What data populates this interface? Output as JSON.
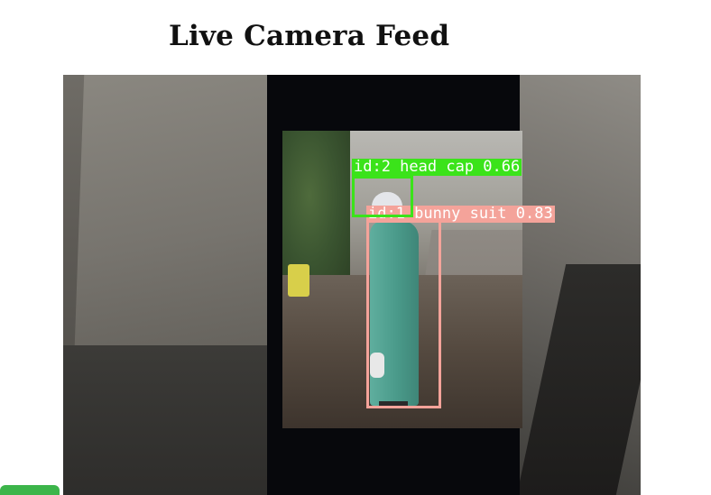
{
  "page": {
    "title": "Live Camera Feed"
  },
  "feed": {
    "detections": [
      {
        "label": "id:1 bunny suit 0.83",
        "color": "#f4a39a"
      },
      {
        "label": "id:2 head cap 0.66",
        "color": "#3be31a"
      }
    ]
  },
  "colors": {
    "button_accent": "#3cb54a"
  }
}
